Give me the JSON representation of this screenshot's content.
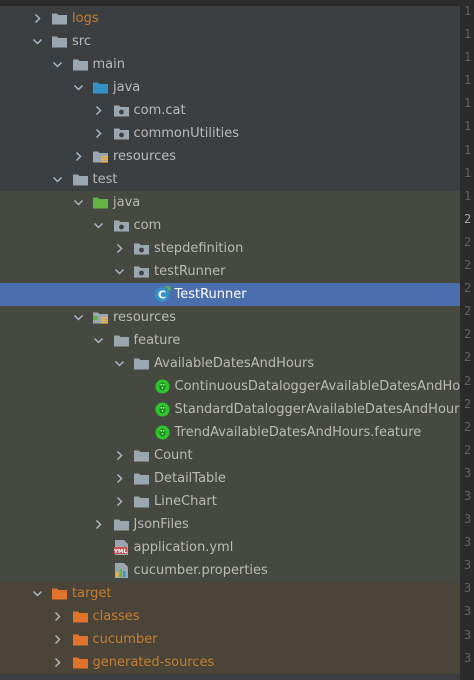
{
  "tree": {
    "items": [
      {
        "label": "logs",
        "depth": 0,
        "expanded": false,
        "icon": "folder-icon",
        "color": "#c57f32",
        "band": "none"
      },
      {
        "label": "src",
        "depth": 0,
        "expanded": true,
        "icon": "folder-icon",
        "color": "#bbbbbb",
        "band": "none"
      },
      {
        "label": "main",
        "depth": 1,
        "expanded": true,
        "icon": "folder-icon",
        "color": "#bbbbbb",
        "band": "none"
      },
      {
        "label": "java",
        "depth": 2,
        "expanded": true,
        "icon": "source-folder-icon",
        "color": "#bbbbbb",
        "band": "none"
      },
      {
        "label": "com.cat",
        "depth": 3,
        "expanded": false,
        "icon": "package-icon",
        "color": "#bbbbbb",
        "band": "none"
      },
      {
        "label": "commonUtilities",
        "depth": 3,
        "expanded": false,
        "icon": "package-icon",
        "color": "#bbbbbb",
        "band": "none"
      },
      {
        "label": "resources",
        "depth": 2,
        "expanded": false,
        "icon": "resources-folder-icon",
        "color": "#bbbbbb",
        "band": "none"
      },
      {
        "label": "test",
        "depth": 1,
        "expanded": true,
        "icon": "folder-icon",
        "color": "#bbbbbb",
        "band": "none"
      },
      {
        "label": "java",
        "depth": 2,
        "expanded": true,
        "icon": "test-source-folder-icon",
        "color": "#bbbbbb",
        "band": "test"
      },
      {
        "label": "com",
        "depth": 3,
        "expanded": true,
        "icon": "package-icon",
        "color": "#bbbbbb",
        "band": "test"
      },
      {
        "label": "stepdefinition",
        "depth": 4,
        "expanded": false,
        "icon": "package-icon",
        "color": "#bbbbbb",
        "band": "test"
      },
      {
        "label": "testRunner",
        "depth": 4,
        "expanded": true,
        "icon": "package-icon",
        "color": "#bbbbbb",
        "band": "test"
      },
      {
        "label": "TestRunner",
        "depth": 5,
        "expanded": null,
        "icon": "java-class-icon",
        "color": "#ffffff",
        "band": "selected"
      },
      {
        "label": "resources",
        "depth": 2,
        "expanded": true,
        "icon": "test-resources-folder-icon",
        "color": "#bbbbbb",
        "band": "test"
      },
      {
        "label": "feature",
        "depth": 3,
        "expanded": true,
        "icon": "folder-icon",
        "color": "#bbbbbb",
        "band": "test"
      },
      {
        "label": "AvailableDatesAndHours",
        "depth": 4,
        "expanded": true,
        "icon": "folder-icon",
        "color": "#bbbbbb",
        "band": "test"
      },
      {
        "label": "ContinuousDataloggerAvailableDatesAndHou",
        "depth": 5,
        "expanded": null,
        "icon": "cucumber-feature-icon",
        "color": "#bbbbbb",
        "band": "test"
      },
      {
        "label": "StandardDataloggerAvailableDatesAndHours.",
        "depth": 5,
        "expanded": null,
        "icon": "cucumber-feature-icon",
        "color": "#bbbbbb",
        "band": "test"
      },
      {
        "label": "TrendAvailableDatesAndHours.feature",
        "depth": 5,
        "expanded": null,
        "icon": "cucumber-feature-icon",
        "color": "#bbbbbb",
        "band": "test"
      },
      {
        "label": "Count",
        "depth": 4,
        "expanded": false,
        "icon": "folder-icon",
        "color": "#bbbbbb",
        "band": "test"
      },
      {
        "label": "DetailTable",
        "depth": 4,
        "expanded": false,
        "icon": "folder-icon",
        "color": "#bbbbbb",
        "band": "test"
      },
      {
        "label": "LineChart",
        "depth": 4,
        "expanded": false,
        "icon": "folder-icon",
        "color": "#bbbbbb",
        "band": "test"
      },
      {
        "label": "JsonFiles",
        "depth": 3,
        "expanded": false,
        "icon": "folder-icon",
        "color": "#bbbbbb",
        "band": "test"
      },
      {
        "label": "application.yml",
        "depth": 3,
        "expanded": null,
        "icon": "yml-file-icon",
        "color": "#bbbbbb",
        "band": "test"
      },
      {
        "label": "cucumber.properties",
        "depth": 3,
        "expanded": null,
        "icon": "properties-file-icon",
        "color": "#bbbbbb",
        "band": "test"
      },
      {
        "label": "target",
        "depth": 0,
        "expanded": true,
        "icon": "excluded-folder-icon",
        "color": "#c57f32",
        "band": "target"
      },
      {
        "label": "classes",
        "depth": 1,
        "expanded": false,
        "icon": "excluded-folder-icon",
        "color": "#c57f32",
        "band": "target"
      },
      {
        "label": "cucumber",
        "depth": 1,
        "expanded": false,
        "icon": "excluded-folder-icon",
        "color": "#c57f32",
        "band": "target"
      },
      {
        "label": "generated-sources",
        "depth": 1,
        "expanded": false,
        "icon": "excluded-folder-icon",
        "color": "#c57f32",
        "band": "target"
      }
    ]
  },
  "gutter": {
    "lines": [
      "1",
      "1",
      "1",
      "1",
      "1",
      "1",
      "1",
      "1",
      "1",
      "2",
      "2",
      "2",
      "2",
      "2",
      "2",
      "2",
      "2",
      "2",
      "2",
      "2",
      "3",
      "3",
      "3",
      "3",
      "3",
      "3",
      "3",
      "3",
      "3"
    ]
  }
}
